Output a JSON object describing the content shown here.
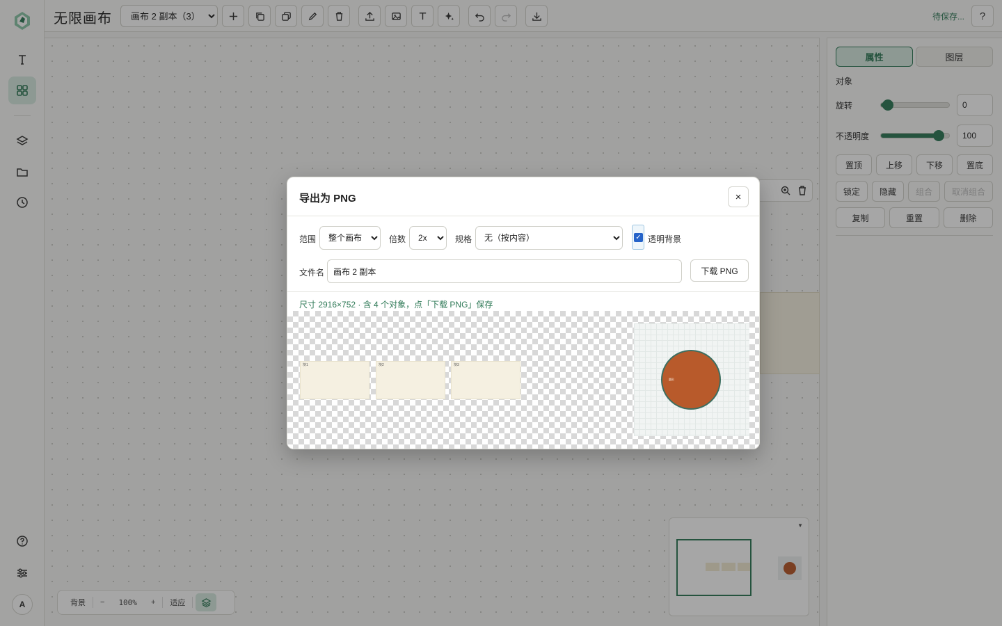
{
  "app": {
    "title": "无限画布"
  },
  "topbar": {
    "canvas_select": {
      "value": "画布 2 副本（3）",
      "options": [
        "画布 2 副本（3）"
      ]
    },
    "tools": [
      "plus-icon",
      "copy-icon",
      "duplicate-icon",
      "pen-icon",
      "trash-icon",
      "upload-icon",
      "image-icon",
      "text-icon",
      "sparkle-icon",
      "undo-icon",
      "redo-icon",
      "download-icon"
    ],
    "save_status": "待保存...",
    "help_label": "?"
  },
  "rail": {
    "items": [
      "text-icon",
      "components-icon",
      "layers-icon",
      "folder-icon",
      "history-icon"
    ],
    "bottom": [
      "help-circle-icon",
      "sliders-icon"
    ],
    "avatar_initial": "A"
  },
  "panel": {
    "tabs": [
      {
        "label": "属性",
        "active": true
      },
      {
        "label": "图层",
        "active": false
      }
    ],
    "section_label": "对象",
    "rotation": {
      "label": "旋转",
      "value": "0",
      "level": 0.1
    },
    "opacity": {
      "label": "不透明度",
      "value": "100",
      "level": 0.85
    },
    "order_buttons": [
      "置顶",
      "上移",
      "下移",
      "置底"
    ],
    "state_buttons": [
      "锁定",
      "隐藏",
      "组合",
      "取消组合"
    ],
    "action_buttons": [
      "复制",
      "重置",
      "删除"
    ]
  },
  "zoombar": {
    "background_label": "背景",
    "minus": "−",
    "zoom": "100%",
    "plus": "+",
    "fit_label": "适应"
  },
  "dialog": {
    "title": "导出为 PNG",
    "close_label": "×",
    "range": {
      "label": "范围",
      "value": "整个画布"
    },
    "scale": {
      "label": "倍数",
      "value": "2x"
    },
    "spec": {
      "label": "规格",
      "value": "无（按内容）"
    },
    "transparent": {
      "label": "透明背景",
      "checked": true,
      "check_glyph": "✓"
    },
    "filename": {
      "label": "文件名",
      "value": "画布 2 副本"
    },
    "download_label": "下载 PNG",
    "info": "尺寸 2916×752 · 含 4 个对象，点「下载 PNG」保存",
    "preview": {
      "cards": [
        "块1",
        "块2",
        "块3"
      ],
      "circle_label": "圆形"
    }
  },
  "colors": {
    "accent": "#2f7a57",
    "accent_bg": "#d7eae0",
    "circle": "#b85a2b",
    "card": "#f5f0e1"
  }
}
